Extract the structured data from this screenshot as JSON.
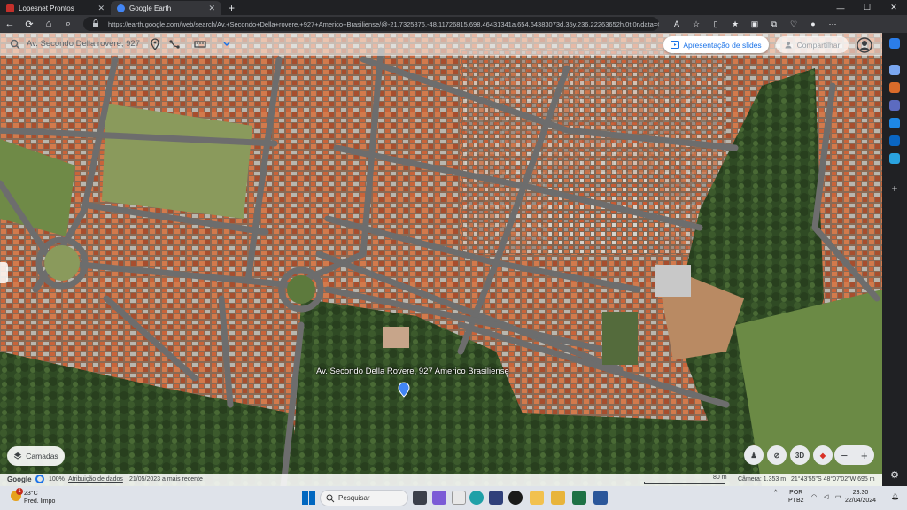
{
  "browser": {
    "tabs": [
      {
        "title": "Lopesnet Prontos"
      },
      {
        "title": "Google Earth"
      }
    ],
    "url": "https://earth.google.com/web/search/Av.+Secondo+Della+rovere,+927+Americo+Brasiliense/@-21.7325876,-48.11726815,698.46431341a,654.64383073d,35y,236.22263652h,0t,0r/data=Cigi..."
  },
  "earth": {
    "search_value": "Av. Secondo Della rovere, 927 Ameri",
    "present_label": "Apresentação de slides",
    "share_label": "Compartilhar",
    "layers_label": "Camadas",
    "pin_label": "Av. Secondo Della Rovere, 927 Americo Brasiliense",
    "view_3d": "3D"
  },
  "status": {
    "brand": "Google",
    "zoom": "100%",
    "attribution": "Atribuição de dados",
    "imagery_date": "21/05/2023 a mais recente",
    "scale": "80 m",
    "camera": "Câmera: 1.353 m",
    "coords": "21°43'55\"S 48°07'02\"W  695 m"
  },
  "taskbar": {
    "weather_temp": "23°C",
    "weather_desc": "Pred. limpo",
    "weather_badge": "1",
    "search_placeholder": "Pesquisar",
    "lang": "POR",
    "layout": "PTB2",
    "time": "23:30",
    "date": "22/04/2024"
  },
  "colors": {
    "accent": "#1a73e8",
    "browser_dark": "#202124",
    "toolbar": "#35363a"
  }
}
